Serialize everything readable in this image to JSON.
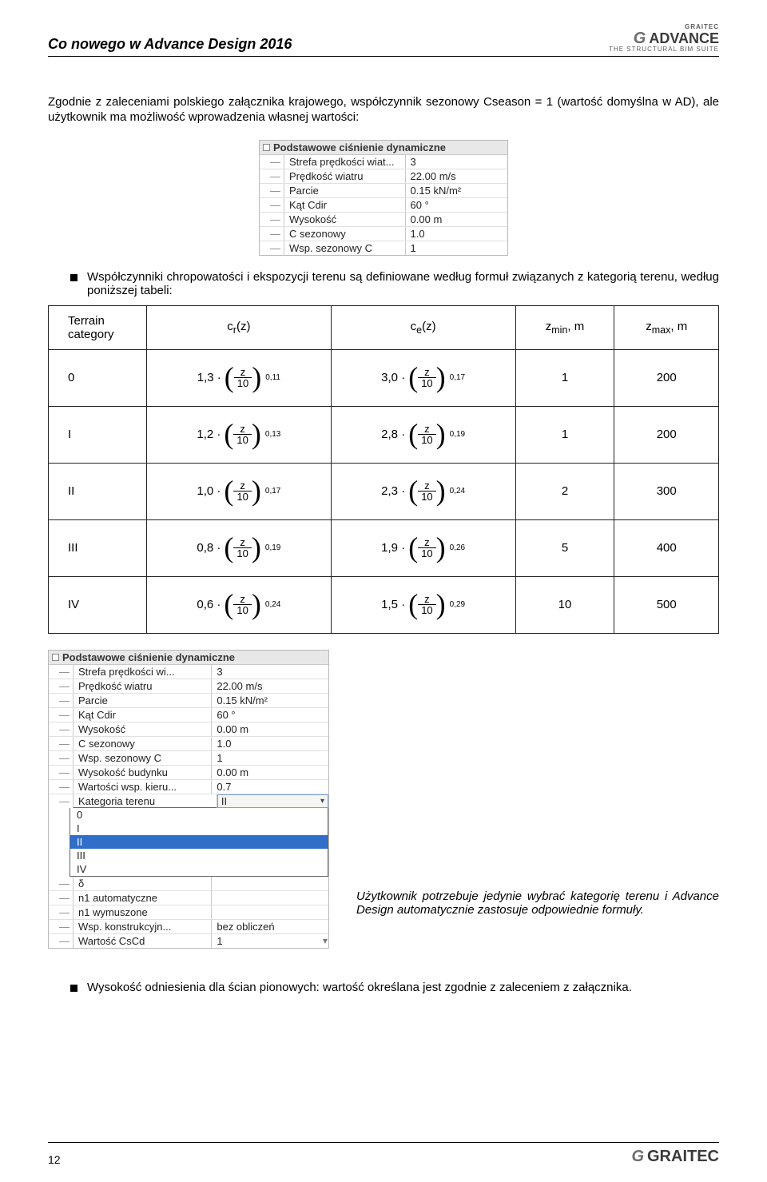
{
  "header": {
    "title": "Co nowego w Advance Design 2016",
    "brand_top": "GRAITEC",
    "brand_name": "ADVANCE",
    "brand_sub": "THE STRUCTURAL BIM SUITE"
  },
  "paragraph1": "Zgodnie z zaleceniami polskiego załącznika krajowego, współczynnik sezonowy   Cseason = 1 (wartość domyślna w AD), ale użytkownik ma możliwość wprowadzenia własnej wartości:",
  "propgrid1": {
    "title": "Podstawowe ciśnienie dynamiczne",
    "rows": [
      {
        "label": "Strefa prędkości wiat...",
        "value": "3"
      },
      {
        "label": "Prędkość wiatru",
        "value": "22.00 m/s"
      },
      {
        "label": "Parcie",
        "value": "0.15 kN/m²"
      },
      {
        "label": "Kąt Cdir",
        "value": "60 °"
      },
      {
        "label": "Wysokość",
        "value": "0.00 m"
      },
      {
        "label": "C sezonowy",
        "value": "1.0"
      },
      {
        "label": "Wsp. sezonowy C",
        "value": "1"
      }
    ]
  },
  "bullet1": "Współczynniki chropowatości i ekspozycji terenu są definiowane według formuł związanych z kategorią terenu, według poniższej tabeli:",
  "chart_data": {
    "type": "table",
    "columns": [
      "Terrain category",
      "c_r(z)",
      "c_e(z)",
      "z_min, m",
      "z_max, m"
    ],
    "rows": [
      {
        "category": "0",
        "cr_coef": 1.3,
        "cr_exp": 0.11,
        "ce_coef": 3.0,
        "ce_exp": 0.17,
        "zmin": 1,
        "zmax": 200
      },
      {
        "category": "I",
        "cr_coef": 1.2,
        "cr_exp": 0.13,
        "ce_coef": 2.8,
        "ce_exp": 0.19,
        "zmin": 1,
        "zmax": 200
      },
      {
        "category": "II",
        "cr_coef": 1.0,
        "cr_exp": 0.17,
        "ce_coef": 2.3,
        "ce_exp": 0.24,
        "zmin": 2,
        "zmax": 300
      },
      {
        "category": "III",
        "cr_coef": 0.8,
        "cr_exp": 0.19,
        "ce_coef": 1.9,
        "ce_exp": 0.26,
        "zmin": 5,
        "zmax": 400
      },
      {
        "category": "IV",
        "cr_coef": 0.6,
        "cr_exp": 0.24,
        "ce_coef": 1.5,
        "ce_exp": 0.29,
        "zmin": 10,
        "zmax": 500
      }
    ]
  },
  "propgrid2": {
    "title": "Podstawowe ciśnienie dynamiczne",
    "rows": [
      {
        "label": "Strefa prędkości wi...",
        "value": "3"
      },
      {
        "label": "Prędkość wiatru",
        "value": "22.00 m/s"
      },
      {
        "label": "Parcie",
        "value": "0.15 kN/m²"
      },
      {
        "label": "Kąt Cdir",
        "value": "60 °"
      },
      {
        "label": "Wysokość",
        "value": "0.00 m"
      },
      {
        "label": "C sezonowy",
        "value": "1.0"
      },
      {
        "label": "Wsp. sezonowy C",
        "value": "1"
      },
      {
        "label": "Wysokość budynku",
        "value": "0.00 m"
      },
      {
        "label": "Wartości wsp. kieru...",
        "value": "0.7"
      },
      {
        "label": "Kategoria terenu",
        "value": "II",
        "dropdown": true
      }
    ],
    "dropdown_options": [
      "0",
      "I",
      "II",
      "III",
      "IV"
    ],
    "dropdown_selected": "II",
    "rows_after": [
      {
        "label": "δ",
        "value": ""
      },
      {
        "label": "n1 automatyczne",
        "value": ""
      },
      {
        "label": "n1 wymuszone",
        "value": ""
      },
      {
        "label": "Wsp. konstrukcyjn...",
        "value": "bez obliczeń"
      },
      {
        "label": "Wartość CsCd",
        "value": "1"
      }
    ]
  },
  "right_note": "Użytkownik potrzebuje jedynie wybrać kategorię terenu i Advance Design automatycznie zastosuje odpowiednie formuły.",
  "bullet2": "Wysokość odniesienia dla ścian pionowych: wartość określana jest zgodnie z zaleceniem z załącznika.",
  "footer": {
    "page": "12",
    "brand_name": "GRAITEC"
  }
}
